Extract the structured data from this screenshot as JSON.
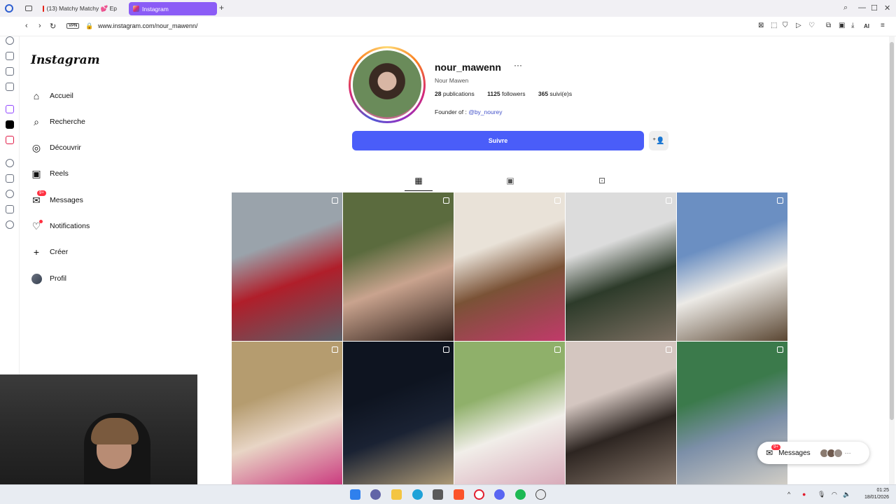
{
  "browser": {
    "tabs": [
      {
        "title": "",
        "icon": "workspace-icon"
      },
      {
        "title": "(13) Matchy Matchy 💕 Ep",
        "icon": "youtube-icon"
      },
      {
        "title": "Instagram",
        "icon": "instagram-icon"
      }
    ],
    "new_tab": "+",
    "url": "www.instagram.com/nour_mawenn/",
    "vpn_label": "VPN",
    "ai_label": "AI"
  },
  "instagram": {
    "logo": "Instagram",
    "nav": [
      {
        "label": "Accueil",
        "icon": "home-icon"
      },
      {
        "label": "Recherche",
        "icon": "search-icon"
      },
      {
        "label": "Découvrir",
        "icon": "compass-icon"
      },
      {
        "label": "Reels",
        "icon": "reels-icon"
      },
      {
        "label": "Messages",
        "icon": "messenger-icon",
        "badge": "9+"
      },
      {
        "label": "Notifications",
        "icon": "heart-icon"
      },
      {
        "label": "Créer",
        "icon": "plus-icon"
      },
      {
        "label": "Profil",
        "icon": "avatar"
      }
    ],
    "profile": {
      "username": "nour_mawenn",
      "more": "···",
      "full_name": "Nour Mawen",
      "posts_count": "28",
      "posts_label": "publications",
      "followers_count": "1125",
      "followers_label": "followers",
      "following_count": "365",
      "following_label": "suivi(e)s",
      "bio_prefix": "Founder of : ",
      "bio_link": "@by_nourey",
      "follow_label": "Suivre"
    },
    "tabs": [
      "grid-icon",
      "reels-icon",
      "tagged-icon"
    ],
    "posts": [
      {
        "type": "carousel",
        "colors": [
          "#9aa3ab",
          "#b01e2a",
          "#5a6068"
        ]
      },
      {
        "type": "video",
        "colors": [
          "#5b6b3e",
          "#c9a38e",
          "#2b1c16"
        ]
      },
      {
        "type": "carousel",
        "colors": [
          "#e9e2d8",
          "#7a5236",
          "#c13a6a"
        ]
      },
      {
        "type": "video",
        "colors": [
          "#dcdcdc",
          "#2d3b2a",
          "#7c6f62"
        ]
      },
      {
        "type": "carousel",
        "colors": [
          "#6b8fc2",
          "#eceae6",
          "#5a4632"
        ]
      },
      {
        "type": "carousel",
        "colors": [
          "#b59c6f",
          "#e8d5c5",
          "#c9307a"
        ]
      },
      {
        "type": "carousel",
        "colors": [
          "#0e1420",
          "#1a2233",
          "#b8a27a"
        ]
      },
      {
        "type": "carousel",
        "colors": [
          "#8fb06a",
          "#f1eee9",
          "#d6a5b6"
        ]
      },
      {
        "type": "carousel",
        "colors": [
          "#d4c6c0",
          "#2d2521",
          "#8b7b6e"
        ]
      },
      {
        "type": "carousel",
        "colors": [
          "#3b7a4b",
          "#7c8fa8",
          "#d7d2c8"
        ]
      }
    ],
    "messages_widget": {
      "label": "Messages",
      "badge": "9+"
    }
  },
  "taskbar": {
    "time": "01:25",
    "date": "18/01/2026"
  }
}
